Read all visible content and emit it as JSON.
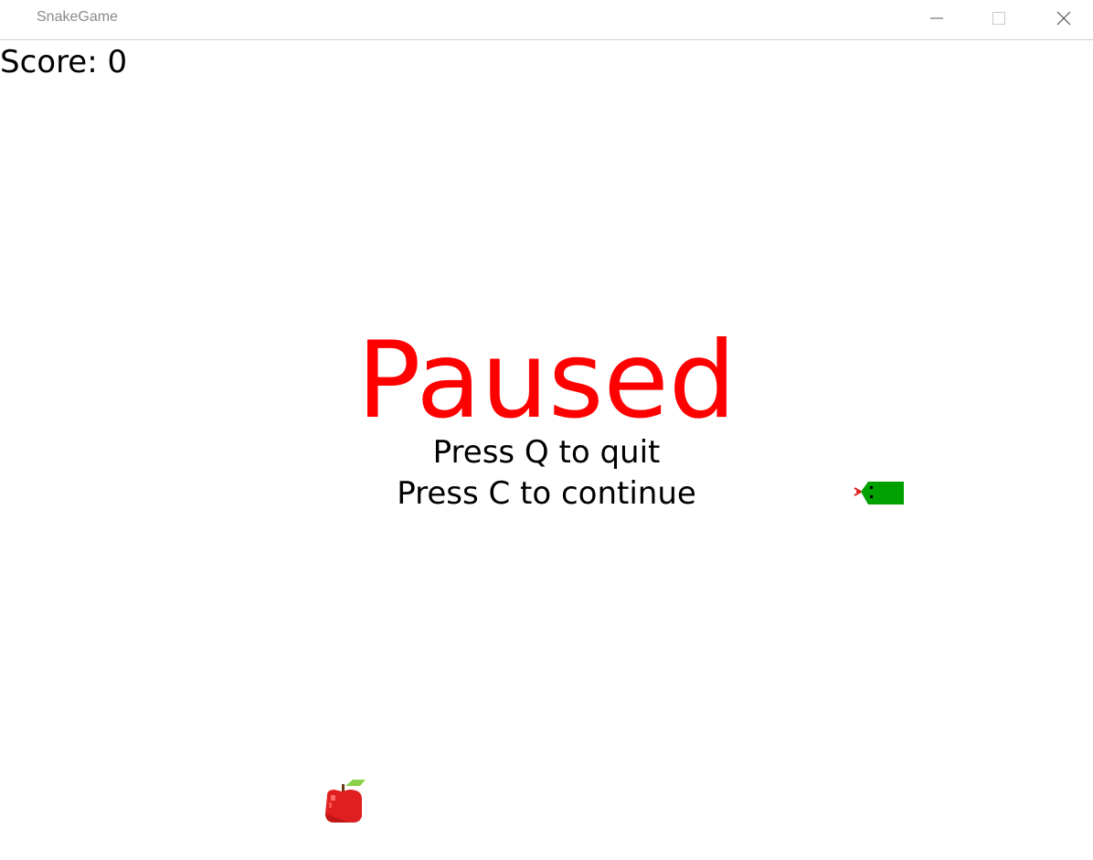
{
  "window": {
    "title": "SnakeGame"
  },
  "game": {
    "score_text": "Score: 0",
    "paused_text": "Paused",
    "quit_text": "Press Q to quit",
    "continue_text": "Press C to continue"
  },
  "colors": {
    "paused": "#ff0000",
    "snake": "#00a000",
    "apple": "#e02020",
    "leaf": "#8ad24a"
  },
  "icons": {
    "minimize": "minimize-icon",
    "maximize": "maximize-icon",
    "close": "close-icon",
    "snake": "snake-head-icon",
    "apple": "apple-icon"
  }
}
